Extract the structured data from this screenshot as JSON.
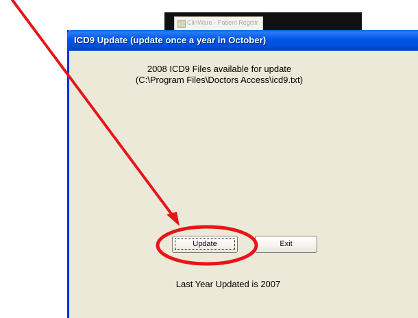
{
  "background_window": {
    "partial_text": "ClinWare - Patient Registr"
  },
  "dialog": {
    "title": "ICD9 Update  (update once a year in October)",
    "info_line_1": "2008 ICD9 Files available for update",
    "info_line_2": "(C:\\Program Files\\Doctors Access\\icd9.txt)",
    "update_label": "Update",
    "exit_label": "Exit",
    "last_updated": "Last Year Updated is 2007"
  },
  "colors": {
    "titlebar": "#0054e3",
    "dialog_bg": "#ece9d8",
    "annotation_red": "#e8141a"
  },
  "annotation": {
    "arrow": "red-arrow-pointing-to-update-button",
    "circle": "red-ellipse-around-update-button"
  }
}
